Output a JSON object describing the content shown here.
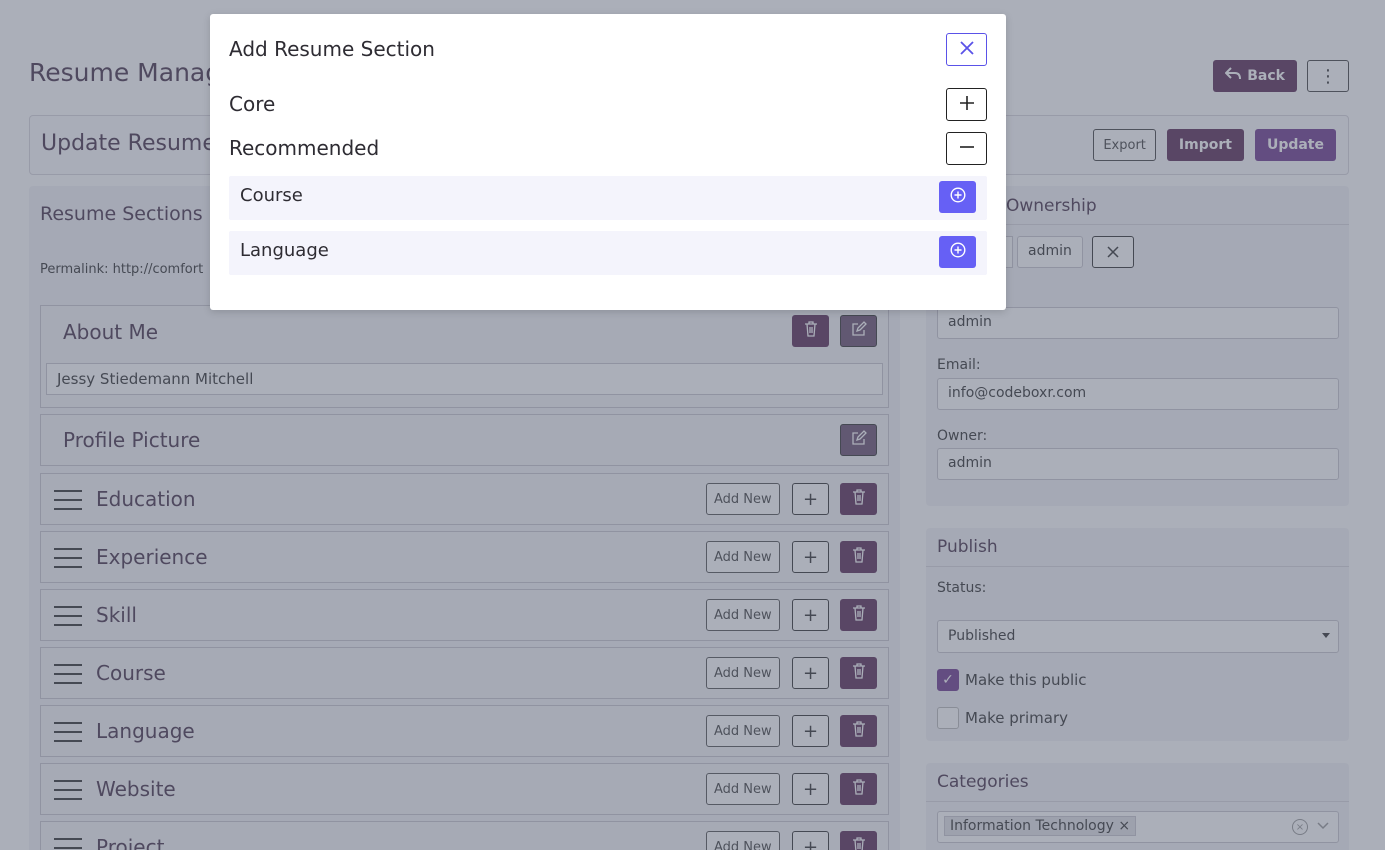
{
  "page": {
    "title": "Resume Manag",
    "back_label": "Back",
    "update_bar_title": "Update Resume",
    "export_label": "Export",
    "import_label": "Import",
    "update_label": "Update"
  },
  "sections": {
    "heading": "Resume Sections",
    "permalink": "Permalink: http://comfort",
    "about_me_label": "About Me",
    "about_me_value": "Jessy Stiedemann Mitchell",
    "profile_picture_label": "Profile Picture",
    "add_new_label": "Add New",
    "rows": [
      {
        "label": "Education"
      },
      {
        "label": "Experience"
      },
      {
        "label": "Skill"
      },
      {
        "label": "Course"
      },
      {
        "label": "Language"
      },
      {
        "label": "Website"
      },
      {
        "label": "Project"
      }
    ]
  },
  "ownership": {
    "heading": "Ownership",
    "user_tag": "admin",
    "username_value": "admin",
    "email_label": "Email:",
    "email_value": "info@codeboxr.com",
    "owner_label": "Owner:",
    "owner_value": "admin"
  },
  "publish": {
    "heading": "Publish",
    "status_label": "Status:",
    "status_value": "Published",
    "make_public_label": "Make this public",
    "make_public_checked": true,
    "make_primary_label": "Make primary",
    "make_primary_checked": false
  },
  "categories": {
    "heading": "Categories",
    "selected_tag": "Information Technology"
  },
  "modal": {
    "title": "Add Resume Section",
    "groups": [
      {
        "label": "Core",
        "expanded": false
      },
      {
        "label": "Recommended",
        "expanded": true
      }
    ],
    "options": [
      {
        "label": "Course"
      },
      {
        "label": "Language"
      }
    ]
  },
  "colors": {
    "accent": "#6660f5",
    "brand_dark": "#5a2c56",
    "overlay": "#58607480"
  }
}
